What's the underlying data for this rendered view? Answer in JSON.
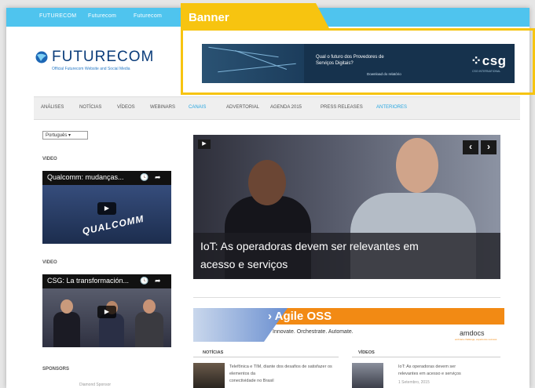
{
  "topbar": {
    "links": [
      "FUTURECOM",
      "Futurecom",
      "Futurecom"
    ]
  },
  "logo": {
    "name": "FUTURECOM",
    "tagline": "Official Futurecom Website and Social Media",
    "brand_color": "#0a3c7a"
  },
  "ad": {
    "line1": "Qual o futuro dos Provedores de",
    "line2": "Serviços Digitais?",
    "cta": "Download do relatório",
    "brand": "csg",
    "brand_prefix": "⁘",
    "brand_sub": "CSG INTERNATIONAL"
  },
  "nav": {
    "items": [
      "ANÁLISES",
      "NOTÍCIAS",
      "VÍDEOS",
      "WEBINARS",
      "CANAIS",
      "ADVERTORIAL",
      "AGENDA 2015",
      "PRESS RELEASES",
      "ANTERIORES"
    ],
    "active_color": "#2aa7e0"
  },
  "sidebar": {
    "language": "Português ▾",
    "video_label_1": "VIDEO",
    "video_label_2": "VIDEO",
    "video1_title": "Qualcomm: mudanças...",
    "video1_brand": "QUALCOMM",
    "video2_title": "CSG: La transformación...",
    "sponsor_label": "SPONSORS",
    "sponsor_sub": "Diamond Sponsor"
  },
  "main_video": {
    "caption_line1": "IoT: As operadoras devem ser relevantes em",
    "caption_line2": "acesso e serviços",
    "prev": "‹",
    "next": "›"
  },
  "agile_ad": {
    "title": "› Agile OSS",
    "subtitle": "Innovate. Orchestrate. Automate.",
    "brand": "amdocs",
    "brand_sub": "embrace challenge, experience success",
    "accent": "#f28a14"
  },
  "news": {
    "section1_label": "NOTÍCIAS",
    "section2_label": "VÍDEOS",
    "item1_text": "Telefônica e TIM, diante dos desafios de satisfazer os elementos da",
    "item1_text2": "conectividade no Brasil",
    "item2_text": "IoT: As operadoras devem ser",
    "item2_text2": "relevantes em acesso e serviços",
    "item2_date": "1 Setembro, 2015"
  },
  "annotation": {
    "label": "Banner",
    "color": "#f7c410"
  }
}
